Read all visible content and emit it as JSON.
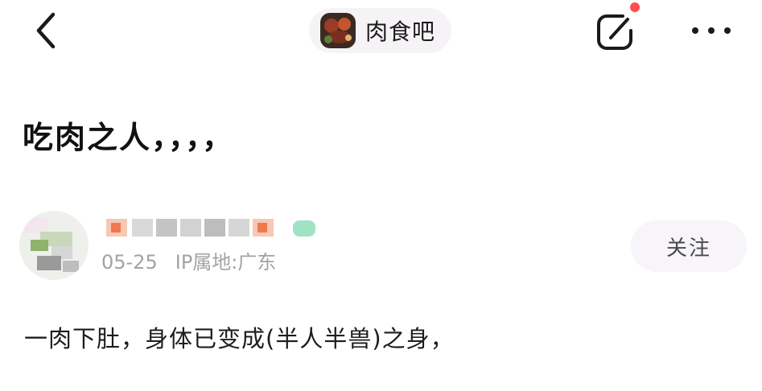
{
  "header": {
    "back_icon": "chevron-left-icon",
    "forum_name": "肉食吧",
    "write_icon": "edit-icon",
    "more_icon": "more-horizontal-icon",
    "notification_dot_color": "#ff4d4f"
  },
  "post": {
    "title": "吃肉之人，，，，",
    "author": {
      "date": "05-25",
      "ip_location": "IP属地:广东",
      "follow_label": "关注"
    },
    "body": "一肉下肚，身体已变成(半人半兽)之身，"
  }
}
